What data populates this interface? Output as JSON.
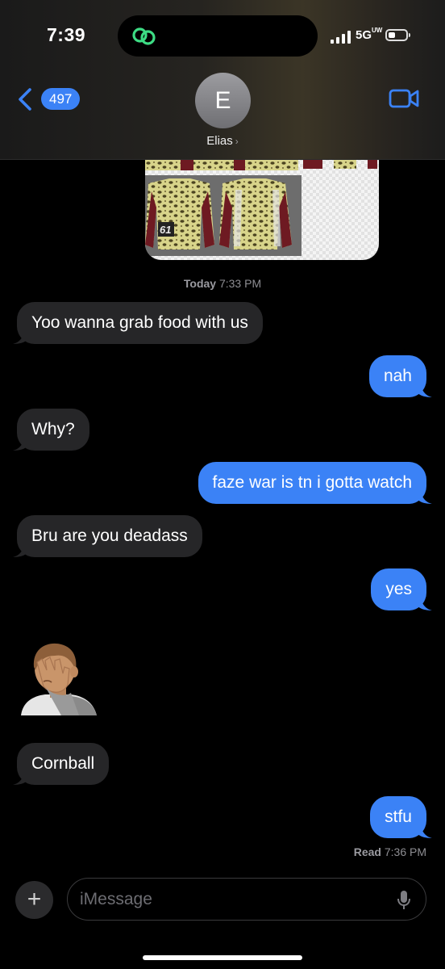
{
  "status_bar": {
    "time": "7:39",
    "network": "5G",
    "network_suffix": "UW"
  },
  "header": {
    "unread_count": "497",
    "avatar_initial": "E",
    "contact_name": "Elias",
    "contact_chevron": "›"
  },
  "conversation": {
    "timestamp_day": "Today",
    "timestamp_time": "7:33 PM",
    "messages": [
      {
        "from": "them",
        "text": "Yoo wanna grab food with us"
      },
      {
        "from": "me",
        "text": "nah"
      },
      {
        "from": "them",
        "text": "Why?"
      },
      {
        "from": "me",
        "text": "faze war is tn i gotta watch"
      },
      {
        "from": "them",
        "text": "Bru are you deadass"
      },
      {
        "from": "me",
        "text": "yes"
      },
      {
        "from": "them",
        "emoji": "person-facepalming"
      },
      {
        "from": "them",
        "text": "Cornball"
      },
      {
        "from": "me",
        "text": "stfu"
      }
    ],
    "read_label": "Read",
    "read_time": "7:36 PM"
  },
  "composer": {
    "plus_label": "+",
    "placeholder": "iMessage"
  },
  "colors": {
    "sent_bubble": "#3b82f6",
    "received_bubble": "#262628",
    "background": "#000000"
  }
}
